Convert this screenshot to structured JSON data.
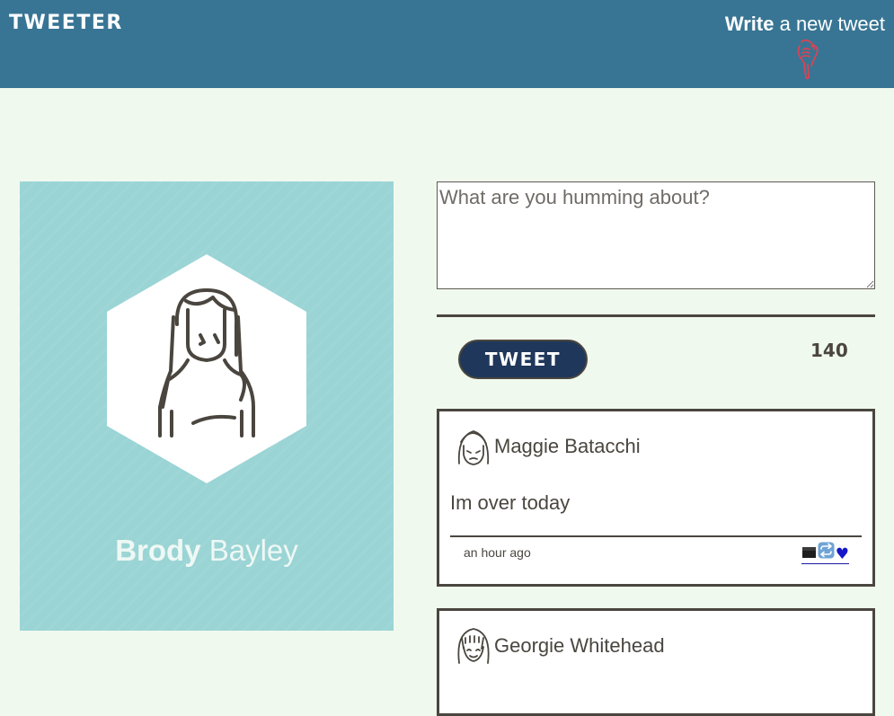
{
  "nav": {
    "brand": "TWEETER",
    "compose_bold": "Write",
    "compose_rest": " a new tweet",
    "compose_icon": "pointing-hand-down-icon"
  },
  "profile": {
    "first_name": "Brody",
    "last_name": " Bayley",
    "avatar_icon": "person-avatar-icon"
  },
  "composer": {
    "placeholder": "What are you humming about?",
    "value": "",
    "button_label": "TWEET",
    "counter": "140"
  },
  "tweets": [
    {
      "author": "Maggie Batacchi",
      "text": "Im over today",
      "timestamp": "an hour ago",
      "actions": [
        "flag-icon",
        "retweet-icon",
        "heart-icon"
      ]
    },
    {
      "author": "Georgie Whitehead",
      "text": "",
      "timestamp": ""
    }
  ],
  "colors": {
    "nav_bg": "#387594",
    "page_bg": "#f0f9ee",
    "profile_bg": "#9ad4d5",
    "button_bg": "#1f375a",
    "text": "#4a463f"
  },
  "icons": {
    "heart_glyph": "♥"
  }
}
